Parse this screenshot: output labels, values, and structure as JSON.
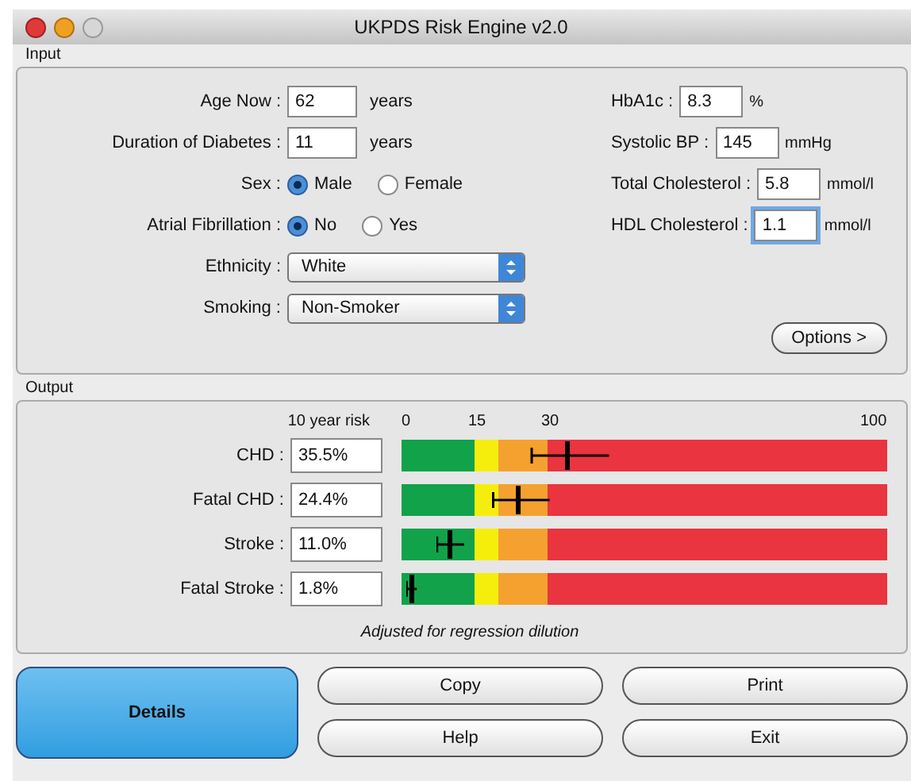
{
  "window": {
    "title": "UKPDS Risk Engine v2.0"
  },
  "input": {
    "title": "Input",
    "left": [
      {
        "kind": "field",
        "label": "Age Now :",
        "value": "62",
        "unit": "years",
        "focused": false
      },
      {
        "kind": "field",
        "label": "Duration of Diabetes :",
        "value": "11",
        "unit": "years",
        "focused": false
      },
      {
        "kind": "radio",
        "label": "Sex :",
        "options": [
          {
            "label": "Male",
            "selected": true
          },
          {
            "label": "Female",
            "selected": false
          }
        ]
      },
      {
        "kind": "radio",
        "label": "Atrial Fibrillation :",
        "options": [
          {
            "label": "No",
            "selected": true
          },
          {
            "label": "Yes",
            "selected": false
          }
        ]
      },
      {
        "kind": "select",
        "label": "Ethnicity :",
        "value": "White"
      },
      {
        "kind": "select",
        "label": "Smoking :",
        "value": "Non-Smoker"
      }
    ],
    "right": [
      {
        "label": "HbA1c :",
        "value": "8.3",
        "unit": "%",
        "focused": false
      },
      {
        "label": "Systolic BP :",
        "value": "145",
        "unit": "mmHg",
        "focused": false
      },
      {
        "label": "Total Cholesterol :",
        "value": "5.8",
        "unit": "mmol/l",
        "focused": false
      },
      {
        "label": "HDL Cholesterol :",
        "value": "1.1",
        "unit": "mmol/l",
        "focused": true
      }
    ],
    "options_button": "Options >"
  },
  "output": {
    "title": "Output",
    "header": "10 year risk",
    "ticks": [
      "0",
      "15",
      "30",
      "100"
    ],
    "zones": [
      {
        "color": "#12a24a"
      },
      {
        "color": "#f5ee0c"
      },
      {
        "color": "#f4a130"
      },
      {
        "color": "#ea3440"
      }
    ],
    "risks": [
      {
        "label": "CHD :",
        "value": "35.5%"
      },
      {
        "label": "Fatal CHD :",
        "value": "24.4%"
      },
      {
        "label": "Stroke :",
        "value": "11.0%"
      },
      {
        "label": "Fatal Stroke :",
        "value": "1.8%"
      }
    ],
    "note": "Adjusted for regression dilution"
  },
  "buttons": [
    {
      "label": "Details",
      "default": true
    },
    {
      "label": "Copy",
      "default": false
    },
    {
      "label": "Print",
      "default": false
    },
    {
      "label": "Help",
      "default": false
    },
    {
      "label": "Exit",
      "default": false
    }
  ]
}
